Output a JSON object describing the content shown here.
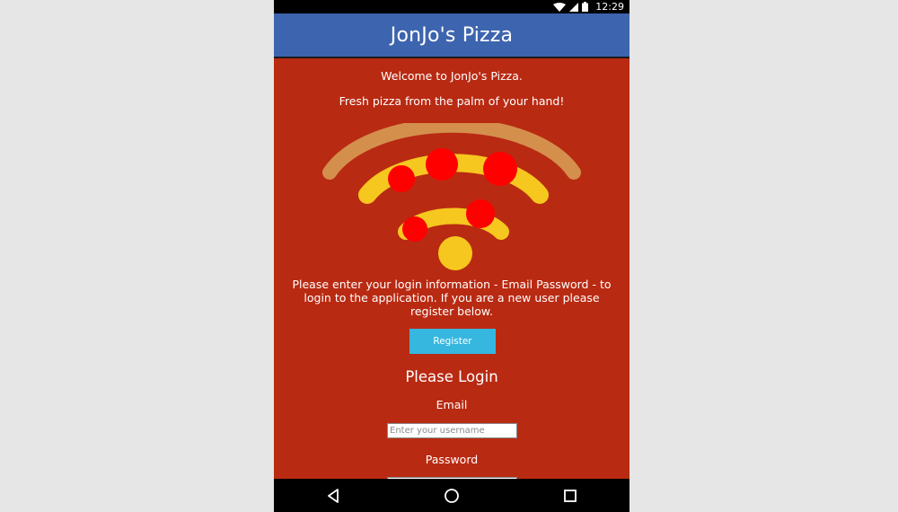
{
  "status_bar": {
    "time": "12:29"
  },
  "app_bar": {
    "title": "JonJo's Pizza"
  },
  "content": {
    "welcome": "Welcome to JonJo's Pizza.",
    "tagline": "Fresh pizza from the palm of your hand!",
    "instructions": "Please enter your login information - Email Password - to login to the application. If you are a new user please register below.",
    "register_label": "Register",
    "login_heading": "Please Login",
    "email_label": "Email",
    "email_placeholder": "Enter your username",
    "password_label": "Password"
  },
  "colors": {
    "background": "#b92a12",
    "app_bar": "#3d64ae",
    "register_button": "#35b7e0",
    "crust": "#d48f4d",
    "cheese": "#f6c71e",
    "pepperoni": "#ff0000"
  },
  "icons": {
    "logo": "wifi-pizza-logo-icon",
    "nav": [
      "back-icon",
      "home-icon",
      "recents-icon"
    ],
    "status": [
      "wifi-icon",
      "signal-icon",
      "battery-icon"
    ]
  }
}
